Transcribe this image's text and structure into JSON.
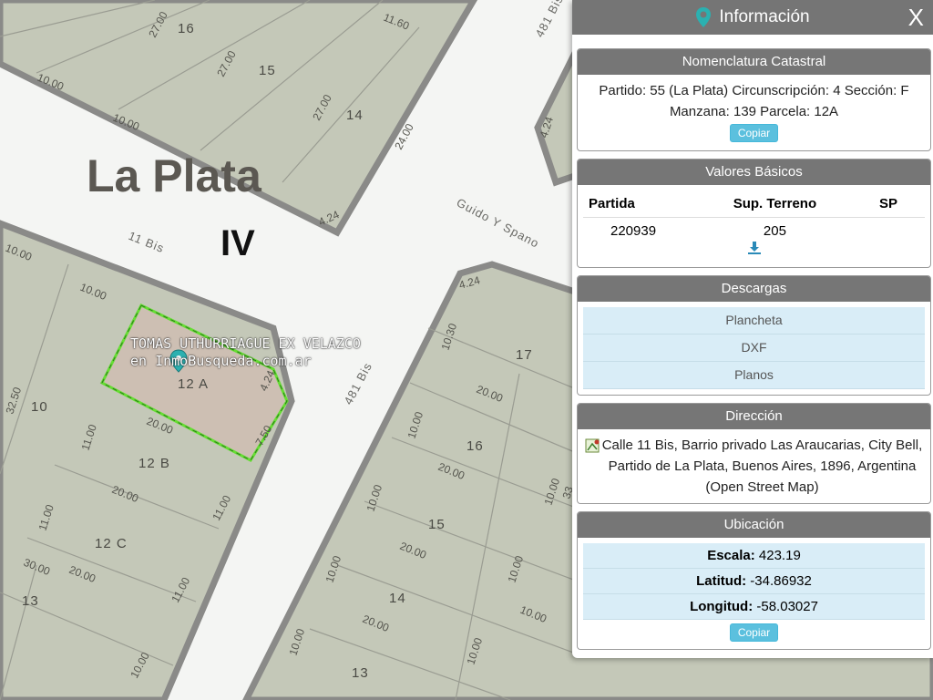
{
  "map": {
    "city_label": "La Plata",
    "section_label": "IV",
    "streets": [
      "11 Bis",
      "481 Bis",
      "Guido Y Spano",
      "481 Bis"
    ],
    "lots": [
      "16",
      "15",
      "14",
      "10",
      "12 A",
      "12 B",
      "12 C",
      "13",
      "17",
      "16",
      "15",
      "14",
      "13"
    ],
    "dims": [
      "27.00",
      "10.00",
      "27.00",
      "10.00",
      "27.00",
      "11.60",
      "24.00",
      "4.24",
      "10.00",
      "10.00",
      "32.50",
      "4.24",
      "7.50",
      "20.00",
      "11.00",
      "11.00",
      "20.00",
      "11.00",
      "30.00",
      "20.00",
      "11.00",
      "10.00",
      "4.24",
      "10.30",
      "20.00",
      "10.00",
      "20.00",
      "10.00",
      "10.00",
      "20.00",
      "10.00",
      "10.00",
      "20.00",
      "10.00",
      "4.24",
      "10.00",
      "10.00",
      "33"
    ],
    "watermark_line1": "TOMAS UTHURRIAGUE EX VELAZCO",
    "watermark_line2": "en InmoBusqueda.com.ar",
    "selected_lot_color": "#66dd33"
  },
  "panel": {
    "title": "Información",
    "close_label": "X",
    "nomenclatura": {
      "title": "Nomenclatura Catastral",
      "line1": "Partido: 55 (La Plata) Circunscripción: 4 Sección: F",
      "line2": "Manzana: 139 Parcela: 12A",
      "copy_label": "Copiar"
    },
    "valores": {
      "title": "Valores Básicos",
      "headers": [
        "Partida",
        "Sup. Terreno",
        "SP"
      ],
      "row": [
        "220939",
        "205",
        ""
      ],
      "download_icon": "download-icon"
    },
    "descargas": {
      "title": "Descargas",
      "items": [
        "Plancheta",
        "DXF",
        "Planos"
      ]
    },
    "direccion": {
      "title": "Dirección",
      "text": "Calle 11 Bis, Barrio privado Las Araucarias, City Bell, Partido de La Plata, Buenos Aires, 1896, Argentina (Open Street Map)"
    },
    "ubicacion": {
      "title": "Ubicación",
      "escala_label": "Escala:",
      "escala": "423.19",
      "latitud_label": "Latitud:",
      "latitud": "-34.86932",
      "longitud_label": "Longitud:",
      "longitud": "-58.03027",
      "copy_label": "Copiar"
    }
  },
  "colors": {
    "block_fill": "#c4c8b8",
    "road": "#f4f5f3",
    "border": "#8a8a88",
    "accent": "#5bc0de",
    "pin": "#2bb0b0"
  }
}
